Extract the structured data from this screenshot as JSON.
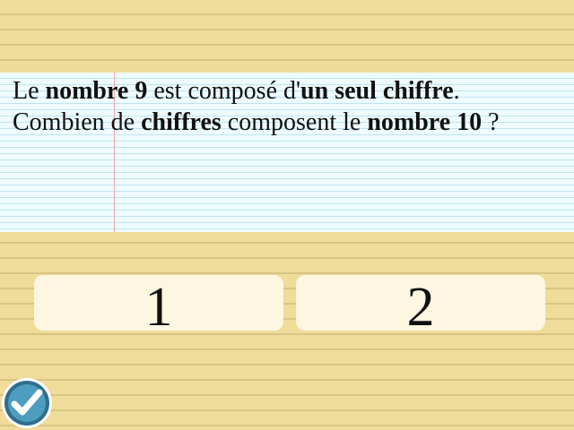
{
  "question": {
    "segments": [
      {
        "text": "Le ",
        "bold": false
      },
      {
        "text": "nombre 9",
        "bold": true
      },
      {
        "text": " est composé d'",
        "bold": false
      },
      {
        "text": "un seul chiffre",
        "bold": true
      },
      {
        "text": ". Combien de ",
        "bold": false
      },
      {
        "text": "chiffres",
        "bold": true
      },
      {
        "text": " composent le ",
        "bold": false
      },
      {
        "text": "nombre 10",
        "bold": true
      },
      {
        "text": " ?",
        "bold": false
      }
    ]
  },
  "answers": [
    {
      "label": "1"
    },
    {
      "label": "2"
    }
  ],
  "validate": {
    "icon": "checkmark-icon"
  },
  "colors": {
    "page_background": "#efdc9a",
    "page_lines": "#d8c483",
    "card_background": "#eefcff",
    "card_lines": "#bfe4ee",
    "margin_line": "#f0a7a7",
    "answer_background": "#fdf6e1",
    "validate_button": "#2e6e8c"
  }
}
